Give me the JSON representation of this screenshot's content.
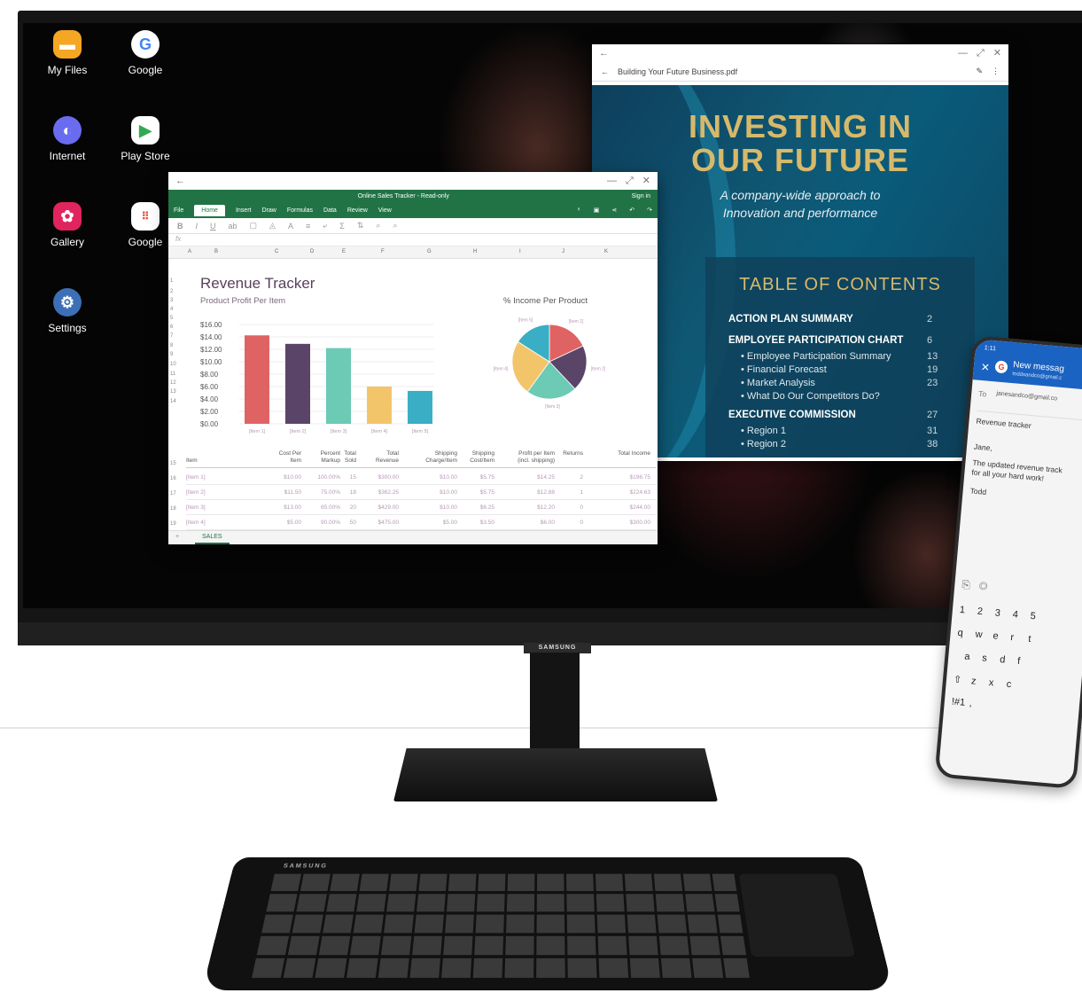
{
  "desktop": {
    "apps": [
      {
        "label": "My Files",
        "icon": "folder-icon",
        "color": "#f5a623"
      },
      {
        "label": "Google",
        "icon": "google-icon",
        "color": "#ffffff"
      },
      {
        "label": "Internet",
        "icon": "internet-icon",
        "color": "#6a6cf0"
      },
      {
        "label": "Play Store",
        "icon": "play-store-icon",
        "color": "#ffffff"
      },
      {
        "label": "Gallery",
        "icon": "gallery-icon",
        "color": "#e0245e"
      },
      {
        "label": "Google",
        "icon": "google-apps-folder-icon",
        "color": "#ffffff"
      },
      {
        "label": "Settings",
        "icon": "gear-icon",
        "color": "#3c6fb5"
      }
    ]
  },
  "excel": {
    "doc_title": "Online Sales Tracker - Read-only",
    "sign_in": "Sign in",
    "tabs": [
      "File",
      "Home",
      "Insert",
      "Draw",
      "Formulas",
      "Data",
      "Review",
      "View"
    ],
    "fx": "fx",
    "columns": [
      "A",
      "B",
      "C",
      "D",
      "E",
      "F",
      "G",
      "H",
      "I",
      "J",
      "K"
    ],
    "rows": [
      "1",
      "2",
      "3",
      "4",
      "5",
      "6",
      "7",
      "8",
      "9",
      "10",
      "11",
      "12",
      "13",
      "14",
      "15",
      "16",
      "17",
      "18",
      "19"
    ],
    "title": "Revenue Tracker",
    "subtitle_left": "Product Profit Per Item",
    "subtitle_right": "% Income Per Product",
    "table_headers": [
      "Item",
      "Cost Per Item",
      "Percent Markup",
      "Total Sold",
      "Total Revenue",
      "Shipping Charge/Item",
      "Shipping Cost/Item",
      "Profit per Item (incl. shipping)",
      "Returns",
      "Total Income"
    ],
    "table_rows": [
      [
        "[Item 1]",
        "$10.00",
        "100.00%",
        "15",
        "$300.00",
        "$10.00",
        "$5.75",
        "$14.25",
        "2",
        "$196.75"
      ],
      [
        "[Item 2]",
        "$11.50",
        "75.00%",
        "18",
        "$362.25",
        "$10.00",
        "$5.75",
        "$12.88",
        "1",
        "$224.63"
      ],
      [
        "[Item 3]",
        "$13.00",
        "65.00%",
        "20",
        "$429.00",
        "$10.00",
        "$6.25",
        "$12.20",
        "0",
        "$244.00"
      ],
      [
        "[Item 4]",
        "$5.00",
        "90.00%",
        "50",
        "$475.00",
        "$5.00",
        "$3.50",
        "$6.00",
        "0",
        "$300.00"
      ]
    ],
    "sheet_tab": "SALES"
  },
  "chart_data": [
    {
      "type": "bar",
      "title": "Product Profit Per Item",
      "categories": [
        "[Item 1]",
        "[Item 2]",
        "[Item 3]",
        "[Item 4]",
        "[Item 5]"
      ],
      "values": [
        14.25,
        12.88,
        12.2,
        6.0,
        5.3
      ],
      "colors": [
        "#e06363",
        "#5a4468",
        "#6ccab5",
        "#f3c56b",
        "#3aaec4"
      ],
      "yticks": [
        "$0.00",
        "$2.00",
        "$4.00",
        "$6.00",
        "$8.00",
        "$10.00",
        "$12.00",
        "$14.00",
        "$16.00"
      ],
      "ylim": [
        0,
        16
      ]
    },
    {
      "type": "pie",
      "title": "% Income Per Product",
      "labels": [
        "[Item 1]",
        "[Item 2]",
        "[Item 3]",
        "[Item 4]",
        "[Item 5]"
      ],
      "values": [
        18,
        20,
        22,
        24,
        16
      ],
      "colors": [
        "#e06363",
        "#5a4468",
        "#6ccab5",
        "#f3c56b",
        "#3aaec4"
      ]
    }
  ],
  "pdf": {
    "filename": "Building Your Future Business.pdf",
    "heading_line1": "INVESTING IN",
    "heading_line2": "OUR FUTURE",
    "tagline_line1": "A company-wide approach to",
    "tagline_line2": "Innovation and performance",
    "toc_title": "TABLE OF CONTENTS",
    "toc": [
      {
        "text": "ACTION PLAN SUMMARY",
        "page": "2",
        "kind": "b"
      },
      {
        "text": "EMPLOYEE PARTICIPATION CHART",
        "page": "6",
        "kind": "b"
      },
      {
        "text": "• Employee Participation Summary",
        "page": "13",
        "kind": "s"
      },
      {
        "text": "• Financial Forecast",
        "page": "19",
        "kind": "s"
      },
      {
        "text": "• Market Analysis",
        "page": "23",
        "kind": "s"
      },
      {
        "text": "• What Do Our Competitors Do?",
        "page": "",
        "kind": "s"
      },
      {
        "text": "EXECUTIVE COMMISSION",
        "page": "27",
        "kind": "b"
      },
      {
        "text": "• Region 1",
        "page": "31",
        "kind": "s"
      },
      {
        "text": "• Region 2",
        "page": "38",
        "kind": "s"
      }
    ]
  },
  "phone": {
    "time": "1:11",
    "header": "New messag",
    "header_sub": "toddsandco@gmail.c",
    "to_label": "To",
    "to_value": "janesandco@gmail.co",
    "subject": "Revenue tracker",
    "greeting": "Jane,",
    "body1": "The updated revenue track",
    "body2": "for all your hard work!",
    "signature": "Todd",
    "key_rows": [
      [
        "1",
        "2",
        "3",
        "4",
        "5"
      ],
      [
        "q",
        "w",
        "e",
        "r",
        "t"
      ],
      [
        "a",
        "s",
        "d",
        "f"
      ],
      [
        "⇧",
        "z",
        "x",
        "c"
      ],
      [
        "!#1",
        ","
      ]
    ]
  },
  "hardware": {
    "monitor_brand": "SAMSUNG",
    "keyboard_brand": "SAMSUNG"
  }
}
